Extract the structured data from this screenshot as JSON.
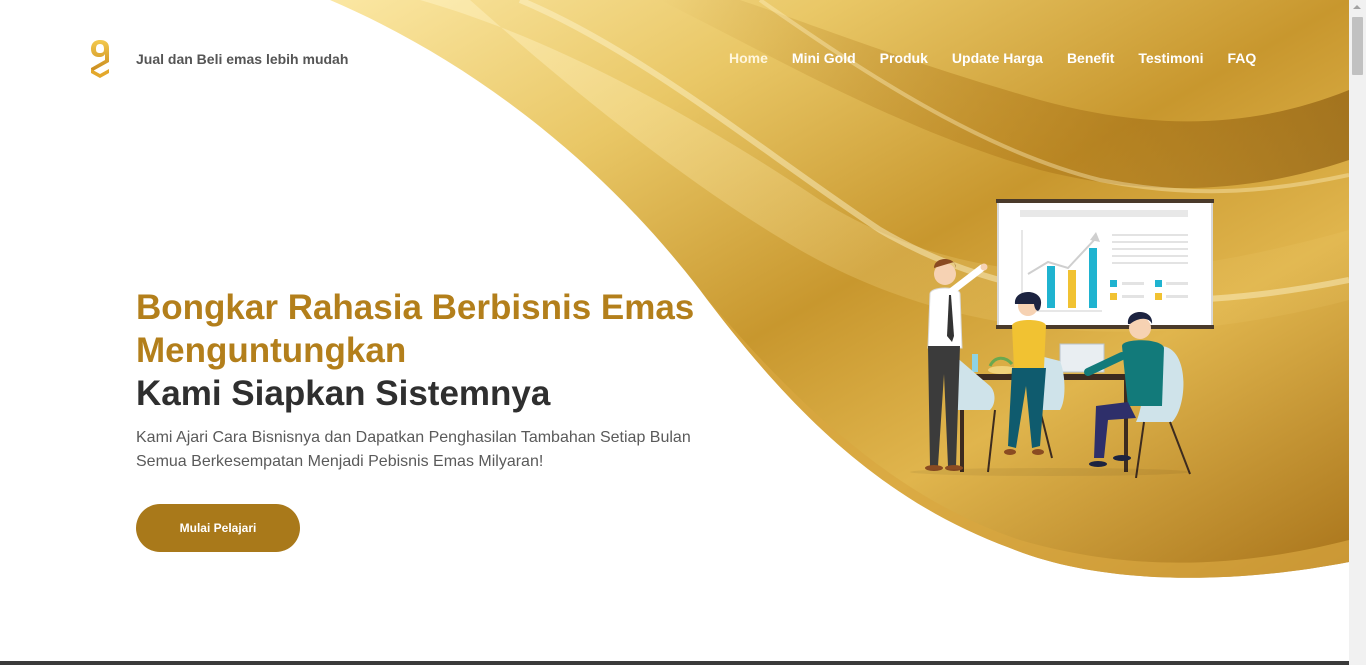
{
  "header": {
    "logo_icon": "gold-9-logo-icon",
    "tagline": "Jual dan Beli emas lebih mudah"
  },
  "nav": {
    "items": [
      {
        "label": "Home",
        "active": true
      },
      {
        "label": "Mini Gold"
      },
      {
        "label": "Produk"
      },
      {
        "label": "Update Harga"
      },
      {
        "label": "Benefit"
      },
      {
        "label": "Testimoni"
      },
      {
        "label": "FAQ"
      }
    ]
  },
  "hero": {
    "title_line1": "Bongkar Rahasia Berbisnis Emas",
    "title_line2": "Menguntungkan",
    "title_line3": "Kami Siapkan Sistemnya",
    "subtitle_line1": "Kami Ajari Cara Bisnisnya dan Dapatkan Penghasilan Tambahan Setiap Bulan",
    "subtitle_line2": "Semua Berkesempatan Menjadi Pebisnis Emas Milyaran!",
    "cta_label": "Mulai Pelajari",
    "illustration_icon": "business-meeting-illustration"
  },
  "colors": {
    "accent_gold": "#b37f1b",
    "button_gold": "#a9791a",
    "heading_dark": "#2f2f2f",
    "text_gray": "#5a5a5a"
  }
}
